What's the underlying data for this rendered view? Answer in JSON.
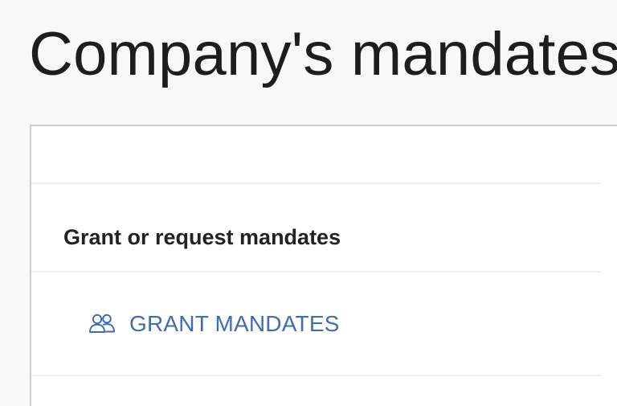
{
  "page": {
    "title": "Company's mandates"
  },
  "mandates_panel": {
    "section_heading": "Grant or request mandates",
    "grant_action": {
      "label": "GRANT MANDATES",
      "icon": "users-icon",
      "color": "#3f6db3"
    }
  },
  "colors": {
    "background": "#f8f8f8",
    "panel_background": "#ffffff",
    "panel_border": "#cfcfcf",
    "divider": "#edf1f7",
    "text": "#222222"
  }
}
